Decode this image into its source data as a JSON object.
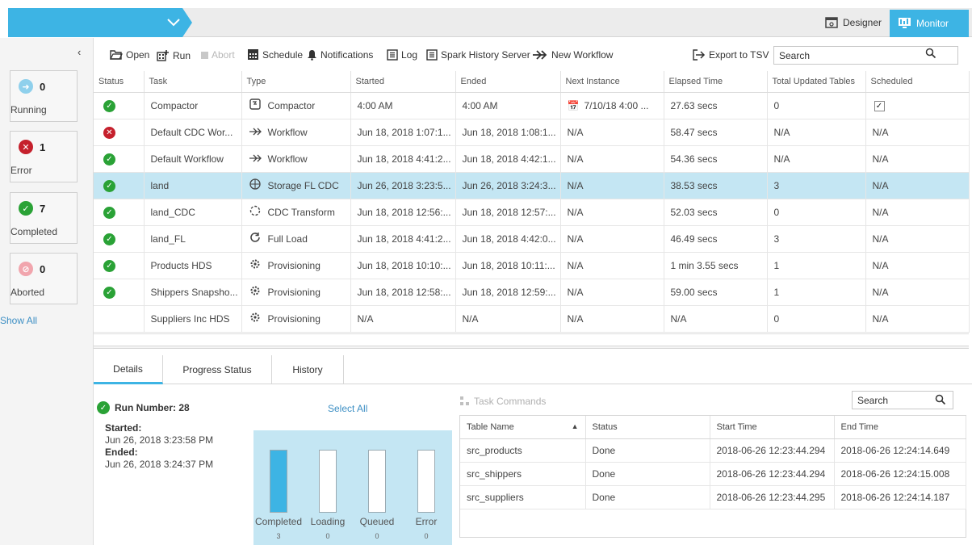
{
  "header": {
    "designer_label": "Designer",
    "monitor_label": "Monitor"
  },
  "sidebar": {
    "collapse_glyph": "‹",
    "cards": [
      {
        "count": "0",
        "label": "Running",
        "icon": "arrow-right-icon",
        "color": "#8fd0ec"
      },
      {
        "count": "1",
        "label": "Error",
        "icon": "x-icon",
        "color": "#c5202c"
      },
      {
        "count": "7",
        "label": "Completed",
        "icon": "check-icon",
        "color": "#2aa236"
      },
      {
        "count": "0",
        "label": "Aborted",
        "icon": "ban-icon",
        "color": "#f1a5ad"
      }
    ],
    "show_all": "Show All"
  },
  "toolbar": {
    "open": "Open",
    "run": "Run",
    "abort": "Abort",
    "schedule": "Schedule",
    "notifications": "Notifications",
    "log": "Log",
    "spark": "Spark History Server",
    "new_workflow": "New Workflow",
    "export": "Export to TSV",
    "search_value": "Search"
  },
  "tasks_table": {
    "columns": [
      "Status",
      "Task",
      "Type",
      "Started",
      "Ended",
      "Next Instance",
      "Elapsed Time",
      "Total Updated Tables",
      "Scheduled"
    ],
    "rows": [
      {
        "status": "ok",
        "task": "Compactor",
        "type": "Compactor",
        "type_icon": "compactor-icon",
        "started": "4:00 AM",
        "ended": "4:00 AM",
        "next": "7/10/18 4:00 ...",
        "elapsed": "27.63 secs",
        "tables": "0",
        "scheduled": "✓"
      },
      {
        "status": "err",
        "task": "Default CDC Wor...",
        "type": "Workflow",
        "type_icon": "workflow-icon",
        "started": "Jun 18, 2018 1:07:1...",
        "ended": "Jun 18, 2018 1:08:1...",
        "next": "N/A",
        "elapsed": "58.47 secs",
        "tables": "N/A",
        "scheduled": "N/A"
      },
      {
        "status": "ok",
        "task": "Default Workflow",
        "type": "Workflow",
        "type_icon": "workflow-icon",
        "started": "Jun 18, 2018 4:41:2...",
        "ended": "Jun 18, 2018 4:42:1...",
        "next": "N/A",
        "elapsed": "54.36 secs",
        "tables": "N/A",
        "scheduled": "N/A"
      },
      {
        "status": "ok",
        "task": "land",
        "type": "Storage FL CDC",
        "type_icon": "storage-icon",
        "started": "Jun 26, 2018 3:23:5...",
        "ended": "Jun 26, 2018 3:24:3...",
        "next": "N/A",
        "elapsed": "38.53 secs",
        "tables": "3",
        "scheduled": "N/A"
      },
      {
        "status": "ok",
        "task": "land_CDC",
        "type": "CDC Transform",
        "type_icon": "cdc-icon",
        "started": "Jun 18, 2018 12:56:...",
        "ended": "Jun 18, 2018 12:57:...",
        "next": "N/A",
        "elapsed": "52.03 secs",
        "tables": "0",
        "scheduled": "N/A"
      },
      {
        "status": "ok",
        "task": "land_FL",
        "type": "Full Load",
        "type_icon": "full-load-icon",
        "started": "Jun 18, 2018 4:41:2...",
        "ended": "Jun 18, 2018 4:42:0...",
        "next": "N/A",
        "elapsed": "46.49 secs",
        "tables": "3",
        "scheduled": "N/A"
      },
      {
        "status": "ok",
        "task": "Products HDS",
        "type": "Provisioning",
        "type_icon": "provisioning-icon",
        "started": "Jun 18, 2018 10:10:...",
        "ended": "Jun 18, 2018 10:11:...",
        "next": "N/A",
        "elapsed": "1 min 3.55 secs",
        "tables": "1",
        "scheduled": "N/A"
      },
      {
        "status": "ok",
        "task": "Shippers Snapsho...",
        "type": "Provisioning",
        "type_icon": "provisioning-icon",
        "started": "Jun 18, 2018 12:58:...",
        "ended": "Jun 18, 2018 12:59:...",
        "next": "N/A",
        "elapsed": "59.00 secs",
        "tables": "1",
        "scheduled": "N/A"
      },
      {
        "status": "",
        "task": "Suppliers Inc HDS",
        "type": "Provisioning",
        "type_icon": "provisioning-icon",
        "started": "N/A",
        "ended": "N/A",
        "next": "N/A",
        "elapsed": "N/A",
        "tables": "0",
        "scheduled": "N/A"
      }
    ]
  },
  "tabs": [
    "Details",
    "Progress Status",
    "History"
  ],
  "details": {
    "run_number": "Run Number: 28",
    "select_all": "Select All",
    "started_label": "Started:",
    "started_value": "Jun 26, 2018 3:23:58 PM",
    "ended_label": "Ended:",
    "ended_value": "Jun 26, 2018 3:24:37 PM",
    "bars": [
      {
        "label": "Completed",
        "count": "3",
        "fill": 1.0
      },
      {
        "label": "Loading",
        "count": "0",
        "fill": 0
      },
      {
        "label": "Queued",
        "count": "0",
        "fill": 0
      },
      {
        "label": "Error",
        "count": "0",
        "fill": 0
      }
    ]
  },
  "task_commands": {
    "label": "Task Commands",
    "search_value": "Search",
    "columns": [
      "Table Name",
      "Status",
      "Start Time",
      "End Time"
    ],
    "rows": [
      {
        "name": "src_products",
        "status": "Done",
        "start": "2018-06-26 12:23:44.294",
        "end": "2018-06-26 12:24:14.649"
      },
      {
        "name": "src_shippers",
        "status": "Done",
        "start": "2018-06-26 12:23:44.294",
        "end": "2018-06-26 12:24:15.008"
      },
      {
        "name": "src_suppliers",
        "status": "Done",
        "start": "2018-06-26 12:23:44.295",
        "end": "2018-06-26 12:24:14.187"
      }
    ]
  },
  "colors": {
    "accent": "#3db4e4",
    "success": "#2aa236",
    "error": "#c5202c",
    "selected_row": "#c4e6f3"
  }
}
